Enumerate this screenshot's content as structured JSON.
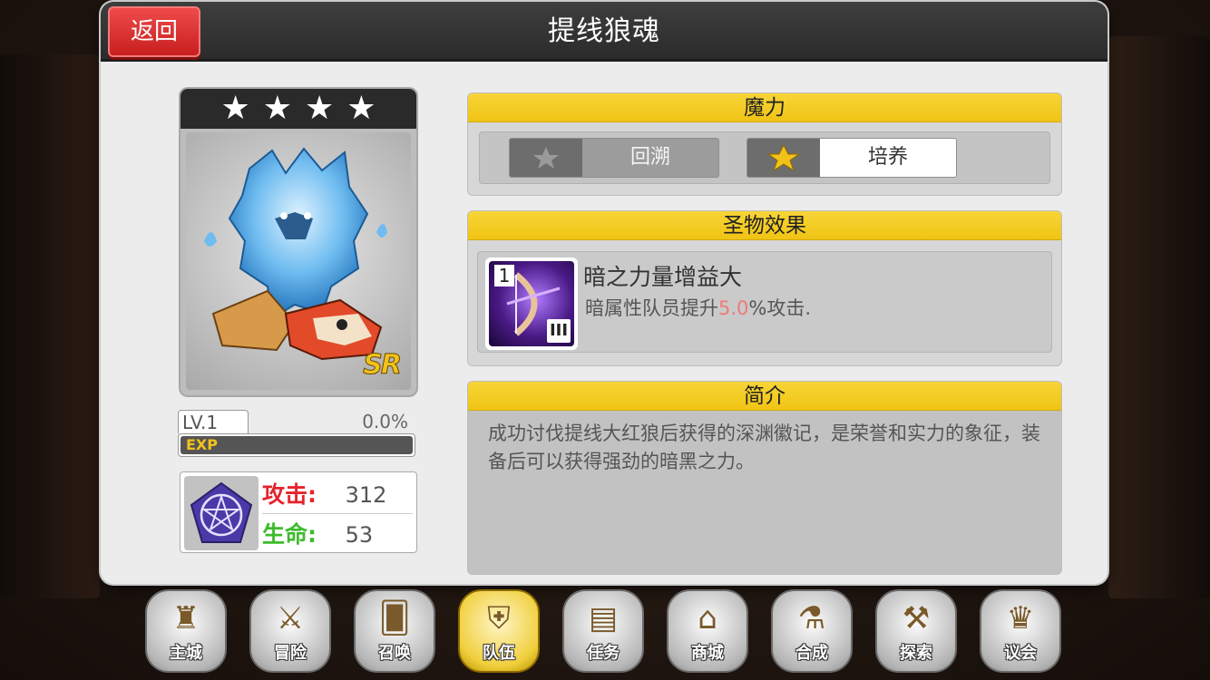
{
  "header": {
    "back_label": "返回",
    "title": "提线狼魂"
  },
  "card": {
    "stars": 4,
    "star_glyph": "★",
    "rarity": "SR"
  },
  "level": {
    "label": "LV.1",
    "percent_text": "0.0%",
    "exp_label": "EXP",
    "progress": 0.0
  },
  "stats": {
    "attack_label": "攻击:",
    "attack_value": "312",
    "hp_label": "生命:",
    "hp_value": "53"
  },
  "magic": {
    "heading": "魔力",
    "rewind_label": "回溯",
    "train_label": "培养"
  },
  "relic": {
    "heading": "圣物效果",
    "index": "1",
    "rank": "III",
    "name": "暗之力量增益大",
    "desc_prefix": "暗属性队员提升",
    "desc_value": "5.0",
    "desc_suffix": "%攻击."
  },
  "intro": {
    "heading": "简介",
    "text": "成功讨伐提线大红狼后获得的深渊徽记，是荣誉和实力的象征，装备后可以获得强劲的暗黑之力。"
  },
  "nav": {
    "items": [
      {
        "label": "主城",
        "icon": "castle-icon"
      },
      {
        "label": "冒险",
        "icon": "swords-icon"
      },
      {
        "label": "召唤",
        "icon": "summon-card-icon"
      },
      {
        "label": "队伍",
        "icon": "team-wings-icon"
      },
      {
        "label": "任务",
        "icon": "quest-book-icon"
      },
      {
        "label": "商城",
        "icon": "shop-icon"
      },
      {
        "label": "合成",
        "icon": "flask-icon"
      },
      {
        "label": "探索",
        "icon": "shovel-icon"
      },
      {
        "label": "议会",
        "icon": "council-icon"
      }
    ],
    "active_index": 3
  },
  "colors": {
    "accent_yellow": "#f0c414",
    "back_red": "#d42a2a",
    "attack_red": "#e4242c",
    "hp_green": "#3dbb2c",
    "highlight_pink": "#f07a7a"
  }
}
